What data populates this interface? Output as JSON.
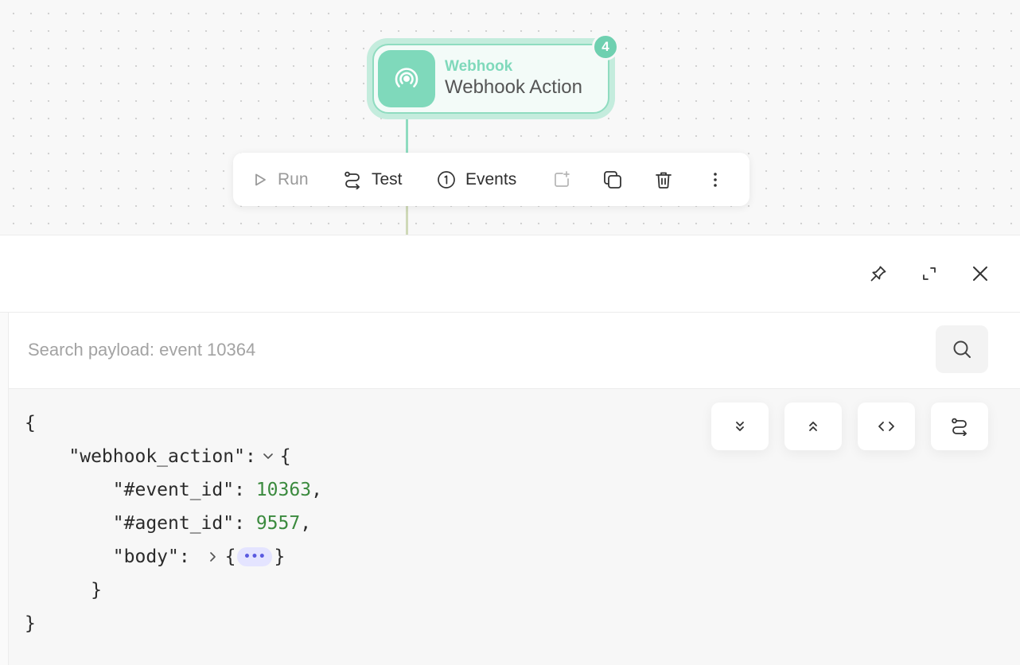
{
  "node": {
    "type": "Webhook",
    "title": "Webhook Action",
    "badge": "4",
    "accent": "#7fd9bb"
  },
  "toolbar": {
    "run_label": "Run",
    "test_label": "Test",
    "events_label": "Events"
  },
  "panel": {
    "search": {
      "placeholder": "Search payload: event 10364",
      "value": ""
    }
  },
  "payload": {
    "open_brace": "{",
    "root_key": "\"webhook_action\":",
    "event_id_key": "\"#event_id\":",
    "event_id_value": "10363",
    "agent_id_key": "\"#agent_id\":",
    "agent_id_value": "9557",
    "body_key": "\"body\":",
    "collapsed_placeholder": "•••",
    "close_inner": "}",
    "close_root": "}"
  }
}
